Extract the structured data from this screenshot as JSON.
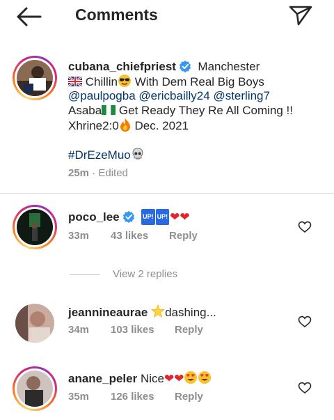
{
  "header": {
    "title": "Comments"
  },
  "caption": {
    "username": "cubana_chiefpriest",
    "location": "Manchester",
    "line2_text": " Chillin",
    "line2_rest": " With Dem Real Big Boys",
    "mentions": [
      "@paulpogba",
      "@ericbailly24",
      "@sterling7"
    ],
    "line4_a": "Asaba",
    "line4_b": " Get Ready They Re All Coming !!",
    "line5_a": "Xhrine2:0",
    "line5_b": " Dec. 2021",
    "hashtag": "#DrEzeMuo",
    "time": "25m",
    "edited": "· Edited"
  },
  "comments": [
    {
      "username": "poco_lee",
      "badge1": "UP!",
      "badge2": "UP!",
      "hearts": "❤❤",
      "time": "33m",
      "likes": "43 likes",
      "reply": "Reply"
    },
    {
      "username": "jeannineaurae",
      "text": "dashing...",
      "time": "34m",
      "likes": "103 likes",
      "reply": "Reply"
    },
    {
      "username": "anane_peler",
      "text": "Nice",
      "hearts": "❤❤",
      "time": "35m",
      "likes": "126 likes",
      "reply": "Reply"
    }
  ],
  "view_replies": "View 2 replies",
  "icons": {
    "back": "arrow-left-icon",
    "send": "direct-send-icon",
    "verified": "verified-badge-icon",
    "like": "heart-outline-icon"
  },
  "colors": {
    "link": "#00376b",
    "muted": "#8e8e8e",
    "verified": "#3897f0",
    "heart": "#e0262b"
  }
}
